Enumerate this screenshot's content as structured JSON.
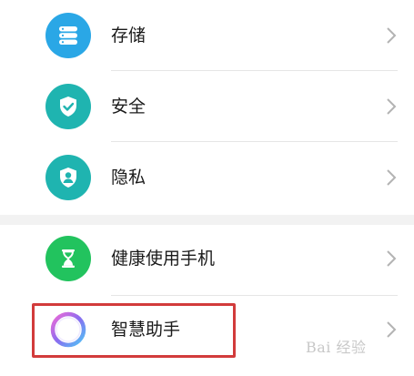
{
  "settings_list": {
    "items": [
      {
        "label": "存储",
        "icon": "storage-icon",
        "color": "#2aa7e6"
      },
      {
        "label": "安全",
        "icon": "shield-check-icon",
        "color": "#1fb4b0"
      },
      {
        "label": "隐私",
        "icon": "privacy-shield-user-icon",
        "color": "#1fb4b0"
      },
      {
        "label": "健康使用手机",
        "icon": "hourglass-icon",
        "color": "#22c35e"
      },
      {
        "label": "智慧助手",
        "icon": "assistant-ring-icon",
        "color": "#8a6cf0"
      }
    ]
  },
  "highlight_color": "#d23b3b",
  "watermark": {
    "text": "Bai 经验"
  }
}
